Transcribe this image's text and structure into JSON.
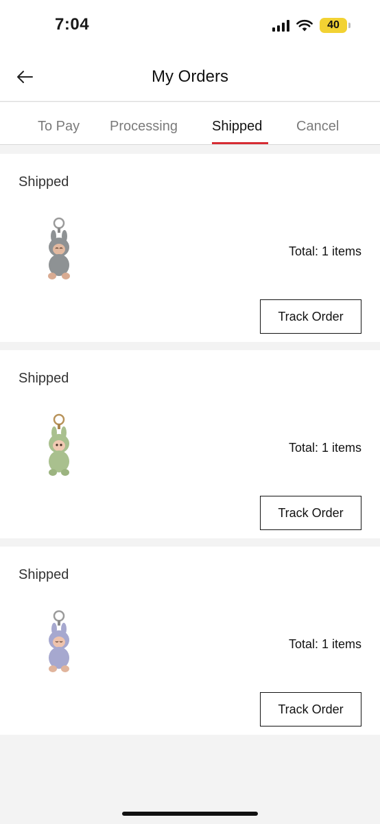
{
  "status_bar": {
    "time": "7:04",
    "battery": "40",
    "battery_color": "#f2d233"
  },
  "header": {
    "title": "My Orders",
    "back_icon": "arrow-left-icon"
  },
  "tabs": [
    {
      "label": "To Pay",
      "active": false
    },
    {
      "label": "Processing",
      "active": false
    },
    {
      "label": "Shipped",
      "active": true
    },
    {
      "label": "Cancel",
      "active": false
    }
  ],
  "accent_color": "#d62b32",
  "orders": [
    {
      "status": "Shipped",
      "total": "Total: 1 items",
      "button": "Track Order",
      "product_icon": "plush-keychain-gray"
    },
    {
      "status": "Shipped",
      "total": "Total: 1 items",
      "button": "Track Order",
      "product_icon": "plush-keychain-green"
    },
    {
      "status": "Shipped",
      "total": "Total: 1 items",
      "button": "Track Order",
      "product_icon": "plush-keychain-lavender"
    }
  ]
}
